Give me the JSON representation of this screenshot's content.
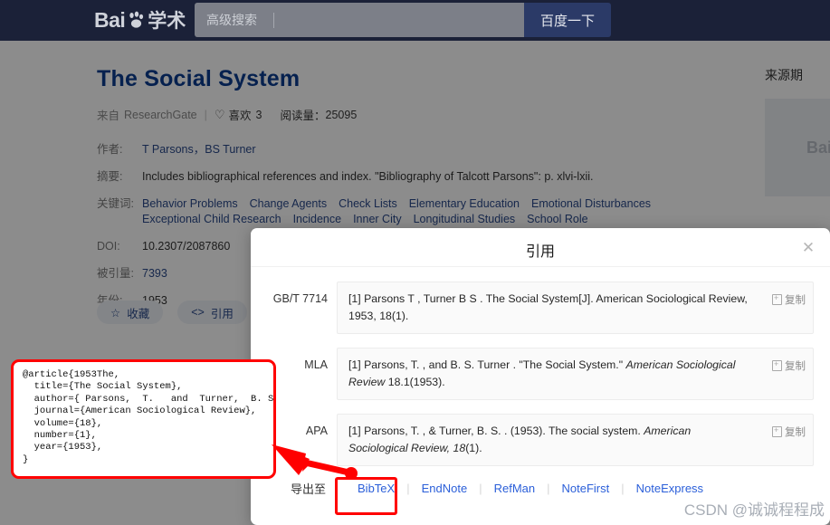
{
  "topbar": {
    "logo_bai": "Bai",
    "logo_xueshu": "学术",
    "advanced_label": "高级搜索",
    "search_value": "",
    "search_placeholder": "",
    "search_button": "百度一下"
  },
  "paper": {
    "title": "The Social System",
    "source_prefix": "来自",
    "source_name": "ResearchGate",
    "divider": "|",
    "heart_icon": "heart-outline-icon",
    "like_label": "喜欢",
    "like_count": "3",
    "reads_label": "阅读量：",
    "reads_count": "25095",
    "rows": [
      {
        "key": "作者:",
        "value": "T Parsons，BS Turner",
        "kind": "link"
      },
      {
        "key": "摘要:",
        "value": "Includes bibliographical references and index. \"Bibliography of Talcott Parsons\": p. xlvi-lxii.",
        "kind": "text"
      }
    ],
    "keywords_key": "关键词:",
    "keywords": [
      "Behavior Problems",
      "Change Agents",
      "Check Lists",
      "Elementary Education",
      "Emotional Disturbances",
      "Exceptional Child Research",
      "Incidence",
      "Inner City",
      "Longitudinal Studies",
      "School Role"
    ],
    "doi_key": "DOI:",
    "doi_value": "10.2307/2087860",
    "cited_key": "被引量:",
    "cited_value": "7393",
    "year_key": "年份:",
    "year_value": "1953",
    "actions": [
      {
        "icon": "star-icon",
        "label": "收藏"
      },
      {
        "icon": "code-brackets-icon",
        "label": "引用"
      }
    ]
  },
  "right_panel": {
    "title": "来源期",
    "logo_text": "Bai"
  },
  "modal": {
    "title": "引用",
    "close_icon": "close-icon",
    "citations": [
      {
        "label": "GB/T 7714",
        "segments": [
          {
            "text": "[1] Parsons T , Turner B S . The Social System[J]. American Sociological Review, 1953, 18(1).",
            "italic": false
          }
        ],
        "copy_label": "复制",
        "copy_icon": "copy-icon"
      },
      {
        "label": "MLA",
        "segments": [
          {
            "text": "[1] Parsons, T. , and B. S. Turner . \"The Social System.\" ",
            "italic": false
          },
          {
            "text": "American Sociological Review",
            "italic": true
          },
          {
            "text": " 18.1(1953).",
            "italic": false
          }
        ],
        "copy_label": "复制",
        "copy_icon": "copy-icon"
      },
      {
        "label": "APA",
        "segments": [
          {
            "text": "[1] Parsons, T. , & Turner, B. S. . (1953). The social system. ",
            "italic": false
          },
          {
            "text": "American Sociological Review, 18",
            "italic": true
          },
          {
            "text": "(1).",
            "italic": false
          }
        ],
        "copy_label": "复制",
        "copy_icon": "copy-icon"
      }
    ],
    "export_label": "导出至",
    "export_links": [
      "BibTeX",
      "EndNote",
      "RefMan",
      "NoteFirst",
      "NoteExpress"
    ],
    "export_separator": "|",
    "highlighted_export": "BibTeX"
  },
  "bibtex_callout": {
    "code": "@article{1953The,\n  title={The Social System},\n  author={ Parsons,  T.   and  Turner,  B. S. },\n  journal={American Sociological Review},\n  volume={18},\n  number={1},\n  year={1953},\n}",
    "border_color": "#ff0000"
  },
  "annotation": {
    "arrow_icon": "red-arrow-icon",
    "arrow_color": "#ff0000"
  },
  "watermark": {
    "text": "CSDN @诚诚程程成"
  },
  "colors": {
    "topbar_bg": "#1b2138",
    "search_btn_bg": "#2b3a67",
    "title_blue": "#0b3d91",
    "link_blue": "#2b4a8b",
    "export_blue": "#2b5fd9",
    "annotation_red": "#ff0000"
  }
}
